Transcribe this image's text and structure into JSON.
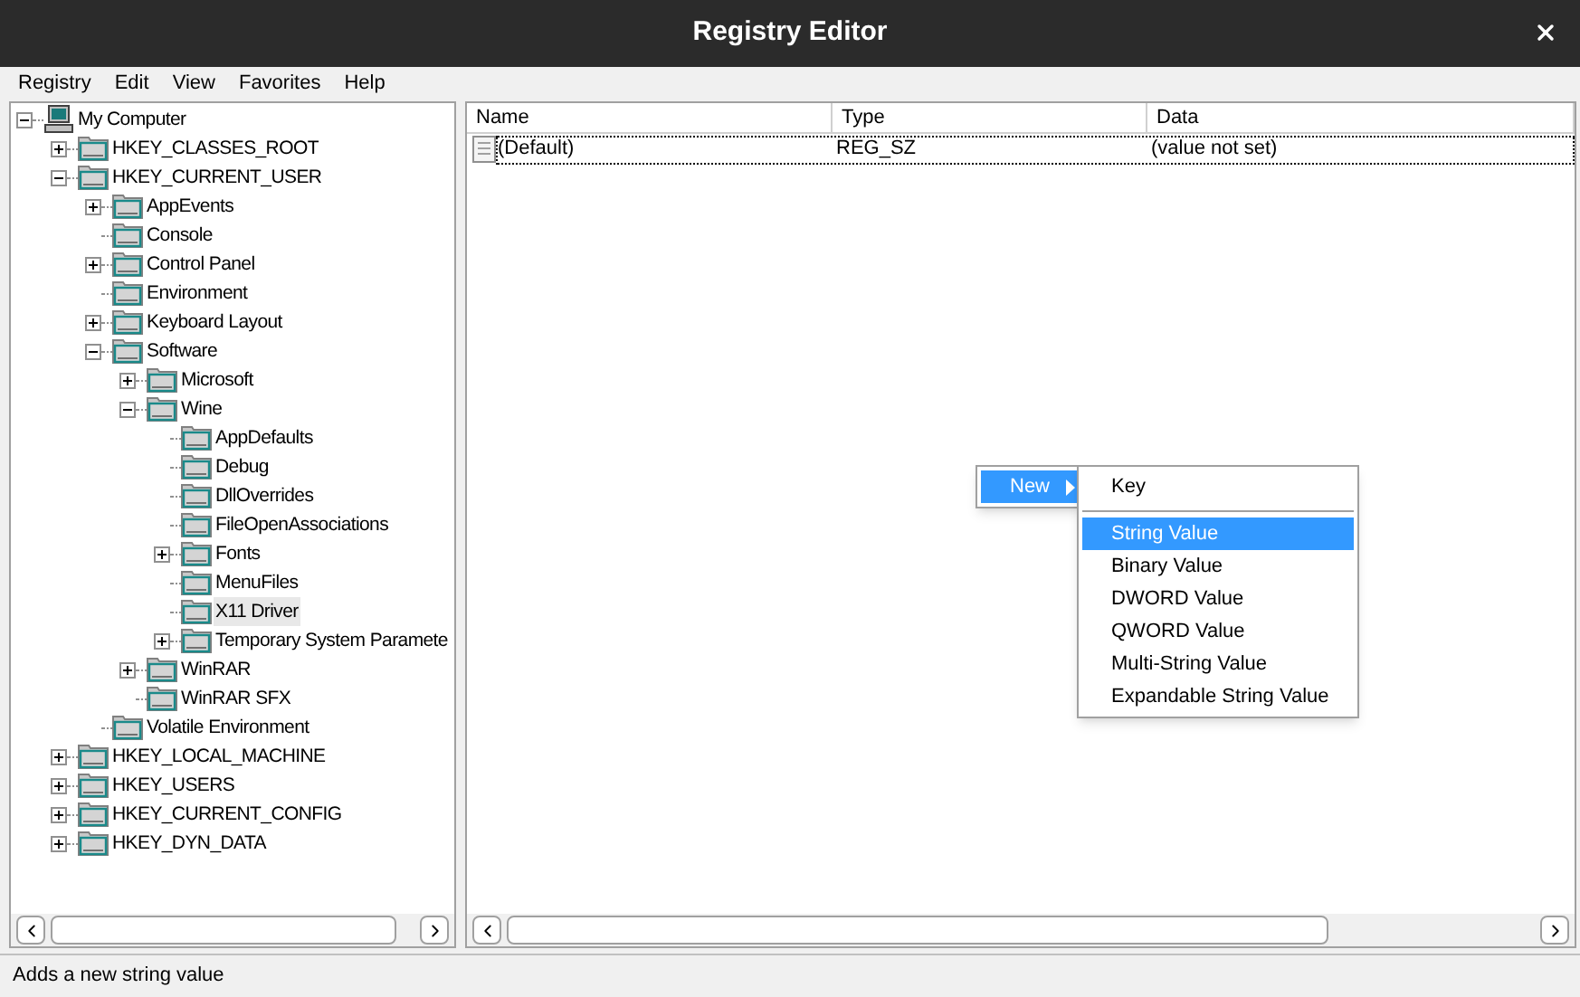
{
  "window": {
    "title": "Registry Editor"
  },
  "menu_bar": [
    "Registry",
    "Edit",
    "View",
    "Favorites",
    "Help"
  ],
  "tree": [
    {
      "label": "My Computer",
      "kind": "computer",
      "expanded": true,
      "selected": false,
      "children": [
        {
          "label": "HKEY_CLASSES_ROOT",
          "kind": "folder",
          "expanded": false,
          "selected": false
        },
        {
          "label": "HKEY_CURRENT_USER",
          "kind": "folder",
          "expanded": true,
          "selected": false,
          "children": [
            {
              "label": "AppEvents",
              "kind": "folder",
              "expanded": false,
              "selected": false
            },
            {
              "label": "Console",
              "kind": "folder",
              "selected": false
            },
            {
              "label": "Control Panel",
              "kind": "folder",
              "expanded": false,
              "selected": false
            },
            {
              "label": "Environment",
              "kind": "folder",
              "selected": false
            },
            {
              "label": "Keyboard Layout",
              "kind": "folder",
              "expanded": false,
              "selected": false
            },
            {
              "label": "Software",
              "kind": "folder",
              "expanded": true,
              "selected": false,
              "children": [
                {
                  "label": "Microsoft",
                  "kind": "folder",
                  "expanded": false,
                  "selected": false
                },
                {
                  "label": "Wine",
                  "kind": "folder",
                  "expanded": true,
                  "selected": false,
                  "children": [
                    {
                      "label": "AppDefaults",
                      "kind": "folder",
                      "selected": false
                    },
                    {
                      "label": "Debug",
                      "kind": "folder",
                      "selected": false
                    },
                    {
                      "label": "DllOverrides",
                      "kind": "folder",
                      "selected": false
                    },
                    {
                      "label": "FileOpenAssociations",
                      "kind": "folder",
                      "selected": false
                    },
                    {
                      "label": "Fonts",
                      "kind": "folder",
                      "expanded": false,
                      "selected": false
                    },
                    {
                      "label": "MenuFiles",
                      "kind": "folder",
                      "selected": false
                    },
                    {
                      "label": "X11 Driver",
                      "kind": "folder",
                      "selected": true
                    },
                    {
                      "label": "Temporary System Paramete",
                      "kind": "folder",
                      "expanded": false,
                      "selected": false
                    }
                  ]
                },
                {
                  "label": "WinRAR",
                  "kind": "folder",
                  "expanded": false,
                  "selected": false
                },
                {
                  "label": "WinRAR SFX",
                  "kind": "folder",
                  "selected": false
                }
              ]
            },
            {
              "label": "Volatile Environment",
              "kind": "folder",
              "selected": false
            }
          ]
        },
        {
          "label": "HKEY_LOCAL_MACHINE",
          "kind": "folder",
          "expanded": false,
          "selected": false
        },
        {
          "label": "HKEY_USERS",
          "kind": "folder",
          "expanded": false,
          "selected": false
        },
        {
          "label": "HKEY_CURRENT_CONFIG",
          "kind": "folder",
          "expanded": false,
          "selected": false
        },
        {
          "label": "HKEY_DYN_DATA",
          "kind": "folder",
          "expanded": false,
          "selected": false
        }
      ]
    }
  ],
  "values_list": {
    "columns": [
      "Name",
      "Type",
      "Data"
    ],
    "rows": [
      {
        "name": "(Default)",
        "type": "REG_SZ",
        "data": "(value not set)"
      }
    ]
  },
  "context_menu": {
    "items": [
      {
        "label": "New",
        "selected": true
      }
    ]
  },
  "submenu": {
    "items": [
      {
        "kind": "item",
        "label": "Key",
        "selected": false
      },
      {
        "kind": "separator"
      },
      {
        "kind": "item",
        "label": "String Value",
        "selected": true
      },
      {
        "kind": "item",
        "label": "Binary Value",
        "selected": false
      },
      {
        "kind": "item",
        "label": "DWORD Value",
        "selected": false
      },
      {
        "kind": "item",
        "label": "QWORD Value",
        "selected": false
      },
      {
        "kind": "item",
        "label": "Multi-String Value",
        "selected": false
      },
      {
        "kind": "item",
        "label": "Expandable String Value",
        "selected": false
      }
    ]
  },
  "status_bar": "Adds a new string value"
}
